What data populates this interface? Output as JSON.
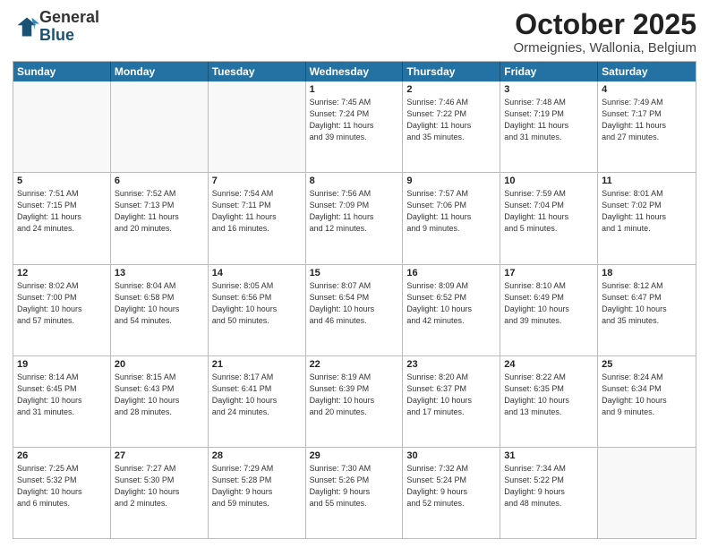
{
  "header": {
    "logo_general": "General",
    "logo_blue": "Blue",
    "month": "October 2025",
    "location": "Ormeignies, Wallonia, Belgium"
  },
  "days_of_week": [
    "Sunday",
    "Monday",
    "Tuesday",
    "Wednesday",
    "Thursday",
    "Friday",
    "Saturday"
  ],
  "weeks": [
    [
      {
        "day": "",
        "info": ""
      },
      {
        "day": "",
        "info": ""
      },
      {
        "day": "",
        "info": ""
      },
      {
        "day": "1",
        "info": "Sunrise: 7:45 AM\nSunset: 7:24 PM\nDaylight: 11 hours\nand 39 minutes."
      },
      {
        "day": "2",
        "info": "Sunrise: 7:46 AM\nSunset: 7:22 PM\nDaylight: 11 hours\nand 35 minutes."
      },
      {
        "day": "3",
        "info": "Sunrise: 7:48 AM\nSunset: 7:19 PM\nDaylight: 11 hours\nand 31 minutes."
      },
      {
        "day": "4",
        "info": "Sunrise: 7:49 AM\nSunset: 7:17 PM\nDaylight: 11 hours\nand 27 minutes."
      }
    ],
    [
      {
        "day": "5",
        "info": "Sunrise: 7:51 AM\nSunset: 7:15 PM\nDaylight: 11 hours\nand 24 minutes."
      },
      {
        "day": "6",
        "info": "Sunrise: 7:52 AM\nSunset: 7:13 PM\nDaylight: 11 hours\nand 20 minutes."
      },
      {
        "day": "7",
        "info": "Sunrise: 7:54 AM\nSunset: 7:11 PM\nDaylight: 11 hours\nand 16 minutes."
      },
      {
        "day": "8",
        "info": "Sunrise: 7:56 AM\nSunset: 7:09 PM\nDaylight: 11 hours\nand 12 minutes."
      },
      {
        "day": "9",
        "info": "Sunrise: 7:57 AM\nSunset: 7:06 PM\nDaylight: 11 hours\nand 9 minutes."
      },
      {
        "day": "10",
        "info": "Sunrise: 7:59 AM\nSunset: 7:04 PM\nDaylight: 11 hours\nand 5 minutes."
      },
      {
        "day": "11",
        "info": "Sunrise: 8:01 AM\nSunset: 7:02 PM\nDaylight: 11 hours\nand 1 minute."
      }
    ],
    [
      {
        "day": "12",
        "info": "Sunrise: 8:02 AM\nSunset: 7:00 PM\nDaylight: 10 hours\nand 57 minutes."
      },
      {
        "day": "13",
        "info": "Sunrise: 8:04 AM\nSunset: 6:58 PM\nDaylight: 10 hours\nand 54 minutes."
      },
      {
        "day": "14",
        "info": "Sunrise: 8:05 AM\nSunset: 6:56 PM\nDaylight: 10 hours\nand 50 minutes."
      },
      {
        "day": "15",
        "info": "Sunrise: 8:07 AM\nSunset: 6:54 PM\nDaylight: 10 hours\nand 46 minutes."
      },
      {
        "day": "16",
        "info": "Sunrise: 8:09 AM\nSunset: 6:52 PM\nDaylight: 10 hours\nand 42 minutes."
      },
      {
        "day": "17",
        "info": "Sunrise: 8:10 AM\nSunset: 6:49 PM\nDaylight: 10 hours\nand 39 minutes."
      },
      {
        "day": "18",
        "info": "Sunrise: 8:12 AM\nSunset: 6:47 PM\nDaylight: 10 hours\nand 35 minutes."
      }
    ],
    [
      {
        "day": "19",
        "info": "Sunrise: 8:14 AM\nSunset: 6:45 PM\nDaylight: 10 hours\nand 31 minutes."
      },
      {
        "day": "20",
        "info": "Sunrise: 8:15 AM\nSunset: 6:43 PM\nDaylight: 10 hours\nand 28 minutes."
      },
      {
        "day": "21",
        "info": "Sunrise: 8:17 AM\nSunset: 6:41 PM\nDaylight: 10 hours\nand 24 minutes."
      },
      {
        "day": "22",
        "info": "Sunrise: 8:19 AM\nSunset: 6:39 PM\nDaylight: 10 hours\nand 20 minutes."
      },
      {
        "day": "23",
        "info": "Sunrise: 8:20 AM\nSunset: 6:37 PM\nDaylight: 10 hours\nand 17 minutes."
      },
      {
        "day": "24",
        "info": "Sunrise: 8:22 AM\nSunset: 6:35 PM\nDaylight: 10 hours\nand 13 minutes."
      },
      {
        "day": "25",
        "info": "Sunrise: 8:24 AM\nSunset: 6:34 PM\nDaylight: 10 hours\nand 9 minutes."
      }
    ],
    [
      {
        "day": "26",
        "info": "Sunrise: 7:25 AM\nSunset: 5:32 PM\nDaylight: 10 hours\nand 6 minutes."
      },
      {
        "day": "27",
        "info": "Sunrise: 7:27 AM\nSunset: 5:30 PM\nDaylight: 10 hours\nand 2 minutes."
      },
      {
        "day": "28",
        "info": "Sunrise: 7:29 AM\nSunset: 5:28 PM\nDaylight: 9 hours\nand 59 minutes."
      },
      {
        "day": "29",
        "info": "Sunrise: 7:30 AM\nSunset: 5:26 PM\nDaylight: 9 hours\nand 55 minutes."
      },
      {
        "day": "30",
        "info": "Sunrise: 7:32 AM\nSunset: 5:24 PM\nDaylight: 9 hours\nand 52 minutes."
      },
      {
        "day": "31",
        "info": "Sunrise: 7:34 AM\nSunset: 5:22 PM\nDaylight: 9 hours\nand 48 minutes."
      },
      {
        "day": "",
        "info": ""
      }
    ]
  ]
}
